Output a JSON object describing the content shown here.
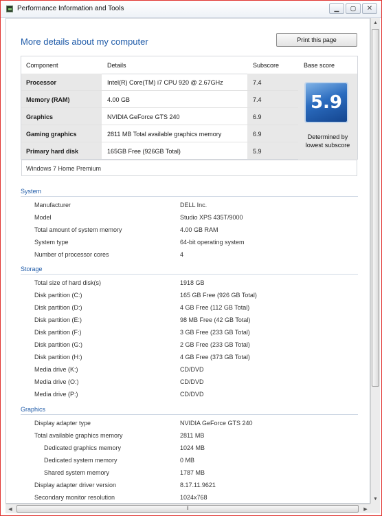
{
  "window": {
    "title": "Performance Information and Tools",
    "min": "▁",
    "max": "▢",
    "close": "✕"
  },
  "heading": "More details about my computer",
  "print_button": "Print this page",
  "score_table": {
    "headers": {
      "component": "Component",
      "details": "Details",
      "subscore": "Subscore",
      "base": "Base score"
    },
    "rows": [
      {
        "component": "Processor",
        "details": "Intel(R) Core(TM) i7 CPU 920 @ 2.67GHz",
        "subscore": "7.4"
      },
      {
        "component": "Memory (RAM)",
        "details": "4.00 GB",
        "subscore": "7.4"
      },
      {
        "component": "Graphics",
        "details": "NVIDIA GeForce GTS 240",
        "subscore": "6.9"
      },
      {
        "component": "Gaming graphics",
        "details": "2811 MB Total available graphics memory",
        "subscore": "6.9"
      },
      {
        "component": "Primary hard disk",
        "details": "165GB Free (926GB Total)",
        "subscore": "5.9"
      }
    ],
    "base_score": "5.9",
    "base_caption": "Determined by lowest subscore",
    "os": "Windows 7 Home Premium"
  },
  "system": {
    "title": "System",
    "rows": [
      {
        "label": "Manufacturer",
        "value": "DELL Inc."
      },
      {
        "label": "Model",
        "value": "Studio XPS 435T/9000"
      },
      {
        "label": "Total amount of system memory",
        "value": "4.00 GB RAM"
      },
      {
        "label": "System type",
        "value": "64-bit operating system"
      },
      {
        "label": "Number of processor cores",
        "value": "4"
      }
    ]
  },
  "storage": {
    "title": "Storage",
    "rows": [
      {
        "label": "Total size of hard disk(s)",
        "value": "1918 GB"
      },
      {
        "label": "Disk partition (C:)",
        "value": "165 GB Free (926 GB Total)"
      },
      {
        "label": "Disk partition (D:)",
        "value": "4 GB Free (112 GB Total)"
      },
      {
        "label": "Disk partition (E:)",
        "value": "98 MB Free (42 GB Total)"
      },
      {
        "label": "Disk partition (F:)",
        "value": "3 GB Free (233 GB Total)"
      },
      {
        "label": "Disk partition (G:)",
        "value": "2 GB Free (233 GB Total)"
      },
      {
        "label": "Disk partition (H:)",
        "value": "4 GB Free (373 GB Total)"
      },
      {
        "label": "Media drive (K:)",
        "value": "CD/DVD"
      },
      {
        "label": "Media drive (O:)",
        "value": "CD/DVD"
      },
      {
        "label": "Media drive (P:)",
        "value": "CD/DVD"
      }
    ]
  },
  "graphics": {
    "title": "Graphics",
    "rows": [
      {
        "label": "Display adapter type",
        "value": "NVIDIA GeForce GTS 240"
      },
      {
        "label": "Total available graphics memory",
        "value": "2811 MB"
      },
      {
        "label": "Dedicated graphics memory",
        "value": "1024 MB"
      },
      {
        "label": "Dedicated system memory",
        "value": "0 MB"
      },
      {
        "label": "Shared system memory",
        "value": "1787 MB"
      },
      {
        "label": "Display adapter driver version",
        "value": "8.17.11.9621"
      },
      {
        "label": "Secondary monitor resolution",
        "value": "1024x768"
      }
    ]
  },
  "scroll": {
    "up": "▲",
    "down": "▼",
    "left": "◀",
    "right": "▶",
    "grip": "⦀"
  },
  "colors": {
    "accent": "#1e5aa8",
    "badge": "#2b6cbf",
    "frame": "#e0332f"
  }
}
